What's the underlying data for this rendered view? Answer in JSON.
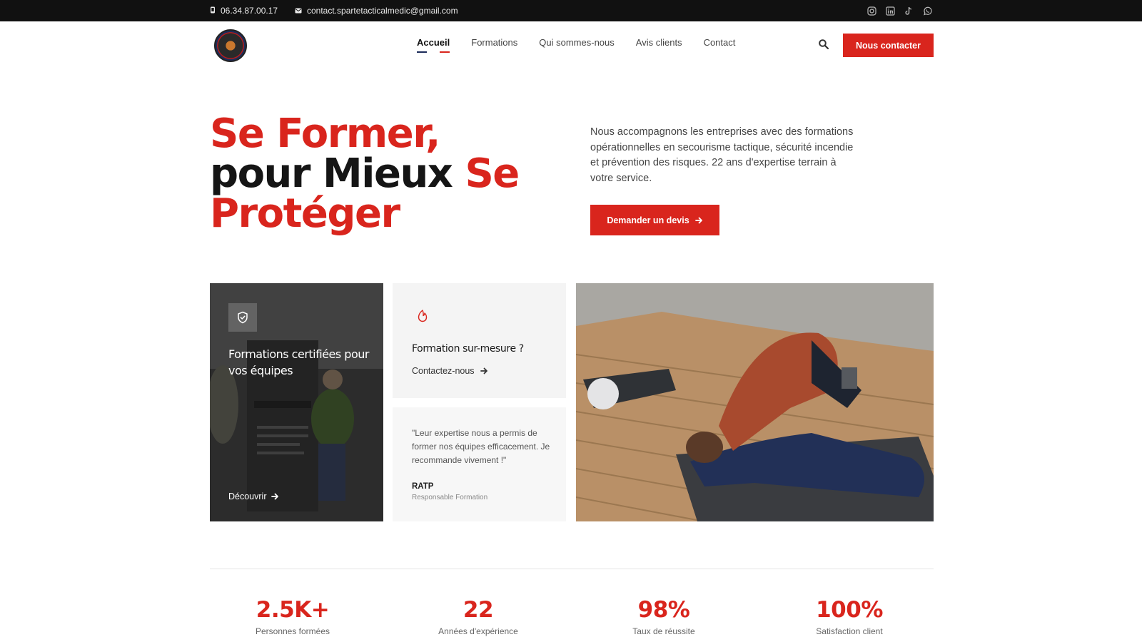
{
  "topbar": {
    "phone": "06.34.87.00.17",
    "email": "contact.spartetacticalmedic@gmail.com",
    "socials": [
      "instagram-icon",
      "linkedin-icon",
      "tiktok-icon",
      "whatsapp-icon"
    ]
  },
  "header": {
    "nav": [
      {
        "label": "Accueil",
        "active": true
      },
      {
        "label": "Formations",
        "active": false
      },
      {
        "label": "Qui sommes-nous",
        "active": false
      },
      {
        "label": "Avis clients",
        "active": false
      },
      {
        "label": "Contact",
        "active": false
      }
    ],
    "cta": "Nous contacter"
  },
  "hero": {
    "title_part1": "Se Former,",
    "title_part2": "pour Mieux ",
    "title_part3": "Se Protéger",
    "text": "Nous accompagnons les entreprises avec des formations opérationnelles en secourisme tactique, sécurité incendie et prévention des risques. 22 ans d'expertise terrain à votre service.",
    "cta": "Demander un devis"
  },
  "cards": {
    "dark": {
      "title": "Formations certifiées pour vos équipes",
      "link": "Découvrir"
    },
    "light": {
      "title": "Formation sur-mesure ?",
      "link": "Contactez-nous"
    },
    "quote": {
      "text": "\"Leur expertise nous a permis de former nos équipes efficacement. Je recommande vivement !\"",
      "author": "RATP",
      "role": "Responsable Formation"
    }
  },
  "stats": [
    {
      "value": "2.5K+",
      "label": "Personnes formées"
    },
    {
      "value": "22",
      "label": "Années d'expérience"
    },
    {
      "value": "98%",
      "label": "Taux de réussite"
    },
    {
      "value": "100%",
      "label": "Satisfaction client"
    }
  ],
  "colors": {
    "accent": "#d9251d",
    "topbar": "#111111",
    "navy": "#1c2c5a"
  }
}
